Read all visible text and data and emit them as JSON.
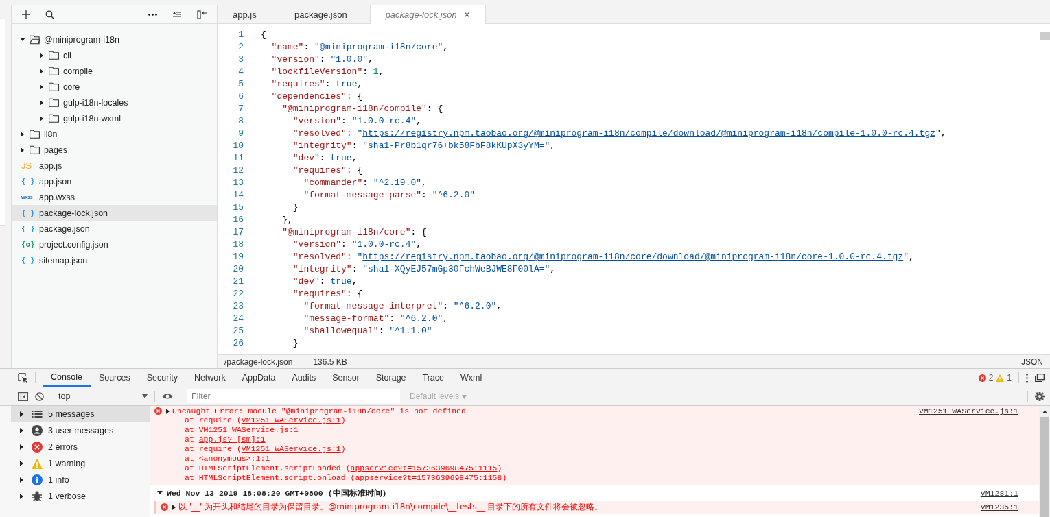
{
  "explorer": {
    "tree": [
      {
        "name": "@miniprogram-i18n",
        "kind": "folder",
        "expanded": true,
        "children": [
          {
            "name": "cli",
            "kind": "folder",
            "expanded": false
          },
          {
            "name": "compile",
            "kind": "folder",
            "expanded": false
          },
          {
            "name": "core",
            "kind": "folder",
            "expanded": false
          },
          {
            "name": "gulp-i18n-locales",
            "kind": "folder",
            "expanded": false
          },
          {
            "name": "gulp-i18n-wxml",
            "kind": "folder",
            "expanded": false
          }
        ]
      },
      {
        "name": "il8n",
        "kind": "folder",
        "expanded": false
      },
      {
        "name": "pages",
        "kind": "folder",
        "expanded": false
      },
      {
        "name": "app.js",
        "kind": "js",
        "icon": "JS",
        "selected": false
      },
      {
        "name": "app.json",
        "kind": "json",
        "icon": "{ }",
        "selected": false
      },
      {
        "name": "app.wxss",
        "kind": "wxss",
        "icon": "wxss",
        "selected": false
      },
      {
        "name": "package-lock.json",
        "kind": "json",
        "icon": "{ }",
        "selected": true
      },
      {
        "name": "package.json",
        "kind": "json",
        "icon": "{ }",
        "selected": false
      },
      {
        "name": "project.config.json",
        "kind": "config",
        "icon": "{o}",
        "selected": false
      },
      {
        "name": "sitemap.json",
        "kind": "json",
        "icon": "{ }",
        "selected": false
      }
    ]
  },
  "editor": {
    "tabs": [
      {
        "label": "app.js",
        "selected": false,
        "preview": false
      },
      {
        "label": "package.json",
        "selected": false,
        "preview": false
      },
      {
        "label": "package-lock.json",
        "selected": true,
        "preview": true,
        "close": "×"
      }
    ],
    "lines": [
      {
        "number": "1",
        "tokens": [
          {
            "kind": "punct",
            "text": "{"
          }
        ]
      },
      {
        "number": "2",
        "tokens": [
          {
            "kind": "key",
            "text": "  \"name\""
          },
          {
            "kind": "punct",
            "text": ": "
          },
          {
            "kind": "string",
            "text": "\"@miniprogram-i18n/core\""
          },
          {
            "kind": "punct",
            "text": ","
          }
        ]
      },
      {
        "number": "3",
        "tokens": [
          {
            "kind": "key",
            "text": "  \"version\""
          },
          {
            "kind": "punct",
            "text": ": "
          },
          {
            "kind": "string",
            "text": "\"1.0.0\""
          },
          {
            "kind": "punct",
            "text": ","
          }
        ]
      },
      {
        "number": "4",
        "tokens": [
          {
            "kind": "key",
            "text": "  \"lockfileVersion\""
          },
          {
            "kind": "punct",
            "text": ": "
          },
          {
            "kind": "number",
            "text": "1"
          },
          {
            "kind": "punct",
            "text": ","
          }
        ]
      },
      {
        "number": "5",
        "tokens": [
          {
            "kind": "key",
            "text": "  \"requires\""
          },
          {
            "kind": "punct",
            "text": ": "
          },
          {
            "kind": "atom",
            "text": "true"
          },
          {
            "kind": "punct",
            "text": ","
          }
        ]
      },
      {
        "number": "6",
        "tokens": [
          {
            "kind": "key",
            "text": "  \"dependencies\""
          },
          {
            "kind": "punct",
            "text": ": {"
          }
        ]
      },
      {
        "number": "7",
        "tokens": [
          {
            "kind": "key",
            "text": "    \"@miniprogram-i18n/compile\""
          },
          {
            "kind": "punct",
            "text": ": {"
          }
        ]
      },
      {
        "number": "8",
        "tokens": [
          {
            "kind": "key",
            "text": "      \"version\""
          },
          {
            "kind": "punct",
            "text": ": "
          },
          {
            "kind": "string",
            "text": "\"1.0.0-rc.4\""
          },
          {
            "kind": "punct",
            "text": ","
          }
        ]
      },
      {
        "number": "9",
        "tokens": [
          {
            "kind": "key",
            "text": "      \"resolved\""
          },
          {
            "kind": "punct",
            "text": ": "
          },
          {
            "kind": "string",
            "text": "\""
          },
          {
            "kind": "link",
            "text": "https://registry.npm.taobao.org/@miniprogram-i18n/compile/download/@miniprogram-i18n/compile-1.0.0-rc.4.tgz"
          },
          {
            "kind": "punct",
            "text": "\","
          }
        ]
      },
      {
        "number": "10",
        "tokens": [
          {
            "kind": "key",
            "text": "      \"integrity\""
          },
          {
            "kind": "punct",
            "text": ": "
          },
          {
            "kind": "string",
            "text": "\"sha1-Pr8b1qr76+bk58FbF8kKUpX3yYM=\""
          },
          {
            "kind": "punct",
            "text": ","
          }
        ]
      },
      {
        "number": "11",
        "tokens": [
          {
            "kind": "key",
            "text": "      \"dev\""
          },
          {
            "kind": "punct",
            "text": ": "
          },
          {
            "kind": "atom",
            "text": "true"
          },
          {
            "kind": "punct",
            "text": ","
          }
        ]
      },
      {
        "number": "12",
        "tokens": [
          {
            "kind": "key",
            "text": "      \"requires\""
          },
          {
            "kind": "punct",
            "text": ": {"
          }
        ]
      },
      {
        "number": "13",
        "tokens": [
          {
            "kind": "key",
            "text": "        \"commander\""
          },
          {
            "kind": "punct",
            "text": ": "
          },
          {
            "kind": "string",
            "text": "\"^2.19.0\""
          },
          {
            "kind": "punct",
            "text": ","
          }
        ]
      },
      {
        "number": "14",
        "tokens": [
          {
            "kind": "key",
            "text": "        \"format-message-parse\""
          },
          {
            "kind": "punct",
            "text": ": "
          },
          {
            "kind": "string",
            "text": "\"^6.2.0\""
          }
        ]
      },
      {
        "number": "15",
        "tokens": [
          {
            "kind": "punct",
            "text": "      }"
          }
        ]
      },
      {
        "number": "16",
        "tokens": [
          {
            "kind": "punct",
            "text": "    },"
          }
        ]
      },
      {
        "number": "17",
        "tokens": [
          {
            "kind": "key",
            "text": "    \"@miniprogram-i18n/core\""
          },
          {
            "kind": "punct",
            "text": ": {"
          }
        ]
      },
      {
        "number": "18",
        "tokens": [
          {
            "kind": "key",
            "text": "      \"version\""
          },
          {
            "kind": "punct",
            "text": ": "
          },
          {
            "kind": "string",
            "text": "\"1.0.0-rc.4\""
          },
          {
            "kind": "punct",
            "text": ","
          }
        ]
      },
      {
        "number": "19",
        "tokens": [
          {
            "kind": "key",
            "text": "      \"resolved\""
          },
          {
            "kind": "punct",
            "text": ": "
          },
          {
            "kind": "string",
            "text": "\""
          },
          {
            "kind": "link",
            "text": "https://registry.npm.taobao.org/@miniprogram-i18n/core/download/@miniprogram-i18n/core-1.0.0-rc.4.tgz"
          },
          {
            "kind": "punct",
            "text": "\","
          }
        ]
      },
      {
        "number": "20",
        "tokens": [
          {
            "kind": "key",
            "text": "      \"integrity\""
          },
          {
            "kind": "punct",
            "text": ": "
          },
          {
            "kind": "string",
            "text": "\"sha1-XQyEJ57mGp30FchWeBJWE8F00lA=\""
          },
          {
            "kind": "punct",
            "text": ","
          }
        ]
      },
      {
        "number": "21",
        "tokens": [
          {
            "kind": "key",
            "text": "      \"dev\""
          },
          {
            "kind": "punct",
            "text": ": "
          },
          {
            "kind": "atom",
            "text": "true"
          },
          {
            "kind": "punct",
            "text": ","
          }
        ]
      },
      {
        "number": "22",
        "tokens": [
          {
            "kind": "key",
            "text": "      \"requires\""
          },
          {
            "kind": "punct",
            "text": ": {"
          }
        ]
      },
      {
        "number": "23",
        "tokens": [
          {
            "kind": "key",
            "text": "        \"format-message-interpret\""
          },
          {
            "kind": "punct",
            "text": ": "
          },
          {
            "kind": "string",
            "text": "\"^6.2.0\""
          },
          {
            "kind": "punct",
            "text": ","
          }
        ]
      },
      {
        "number": "24",
        "tokens": [
          {
            "kind": "key",
            "text": "        \"message-format\""
          },
          {
            "kind": "punct",
            "text": ": "
          },
          {
            "kind": "string",
            "text": "\"^6.2.0\""
          },
          {
            "kind": "punct",
            "text": ","
          }
        ]
      },
      {
        "number": "25",
        "tokens": [
          {
            "kind": "key",
            "text": "        \"shallowequal\""
          },
          {
            "kind": "punct",
            "text": ": "
          },
          {
            "kind": "string",
            "text": "\"^1.1.0\""
          }
        ]
      },
      {
        "number": "26",
        "tokens": [
          {
            "kind": "punct",
            "text": "      }"
          }
        ]
      }
    ],
    "status_bar": {
      "path": "/package-lock.json",
      "size": "136.5 KB",
      "language": "JSON"
    }
  },
  "devtools": {
    "tabs": [
      {
        "label": "Console",
        "selected": true
      },
      {
        "label": "Sources",
        "selected": false
      },
      {
        "label": "Security",
        "selected": false
      },
      {
        "label": "Network",
        "selected": false
      },
      {
        "label": "AppData",
        "selected": false
      },
      {
        "label": "Audits",
        "selected": false
      },
      {
        "label": "Sensor",
        "selected": false
      },
      {
        "label": "Storage",
        "selected": false
      },
      {
        "label": "Trace",
        "selected": false
      },
      {
        "label": "Wxml",
        "selected": false
      }
    ],
    "error_count": "2",
    "warning_count": "1",
    "context": "top",
    "filter": {
      "placeholder": "Filter"
    },
    "levels": "Default levels",
    "filters": [
      {
        "label": "5 messages",
        "kind": "all",
        "selected": true
      },
      {
        "label": "3 user messages",
        "kind": "user",
        "selected": false
      },
      {
        "label": "2 errors",
        "kind": "error",
        "selected": false
      },
      {
        "label": "1 warning",
        "kind": "warning",
        "selected": false
      },
      {
        "label": "1 info",
        "kind": "info",
        "selected": false
      },
      {
        "label": "1 verbose",
        "kind": "verbose",
        "selected": false
      }
    ],
    "messages": [
      {
        "kind": "error",
        "text": "Uncaught Error: module \"@miniprogram-i18n/core\" is not defined",
        "source": "VM1251 WAService.js:1",
        "stack": [
          [
            {
              "kind": "text",
              "text": "at require ("
            },
            {
              "kind": "link",
              "text": "VM1251 WAService.js:1"
            },
            {
              "kind": "text",
              "text": ")"
            }
          ],
          [
            {
              "kind": "text",
              "text": "at "
            },
            {
              "kind": "link",
              "text": "VM1251 WAService.js:1"
            }
          ],
          [
            {
              "kind": "text",
              "text": "at "
            },
            {
              "kind": "link",
              "text": "app.js? [sm]:1"
            }
          ],
          [
            {
              "kind": "text",
              "text": "at require ("
            },
            {
              "kind": "link",
              "text": "VM1251 WAService.js:1"
            },
            {
              "kind": "text",
              "text": ")"
            }
          ],
          [
            {
              "kind": "text",
              "text": "at <anonymous>:1:1"
            }
          ],
          [
            {
              "kind": "text",
              "text": "at HTMLScriptElement.scriptLoaded ("
            },
            {
              "kind": "link",
              "text": "appservice?t=1573639698475:1115"
            },
            {
              "kind": "text",
              "text": ")"
            }
          ],
          [
            {
              "kind": "text",
              "text": "at HTMLScriptElement.script.onload ("
            },
            {
              "kind": "link",
              "text": "appservice?t=1573639698475:1158"
            },
            {
              "kind": "text",
              "text": ")"
            }
          ]
        ]
      },
      {
        "kind": "group",
        "expanded": true,
        "text": "Wed Nov 13 2019 18:08:20 GMT+0800 (中国标准时间)",
        "source": "VM1281:1",
        "children": [
          {
            "kind": "error",
            "text": "以 '__' 为开头和结尾的目录为保留目录。@miniprogram-i18n\\compile\\__tests__ 目录下的所有文件将会被忽略。",
            "source": "VM1235:1"
          }
        ]
      }
    ]
  }
}
